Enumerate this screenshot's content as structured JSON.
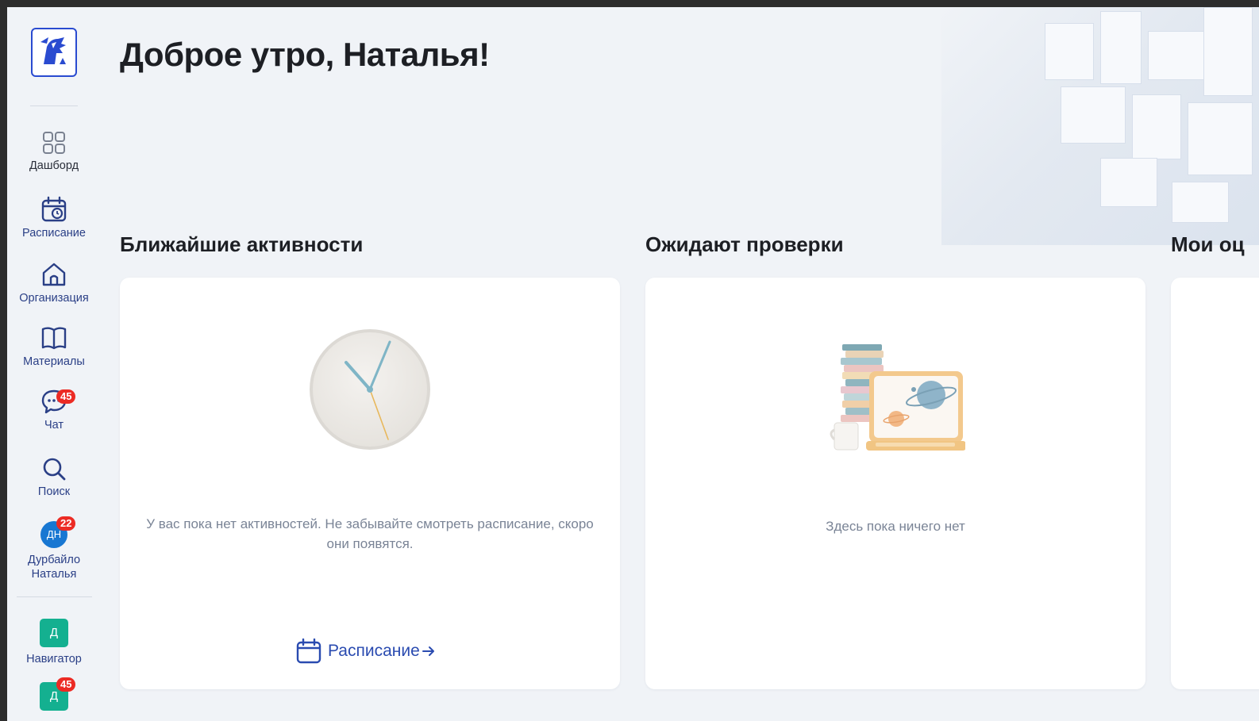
{
  "greeting": "Доброе утро, Наталья!",
  "sidebar": {
    "items": [
      {
        "label": "Дашборд",
        "icon": "grid-icon"
      },
      {
        "label": "Расписание",
        "icon": "calendar-clock-icon"
      },
      {
        "label": "Организация",
        "icon": "home-icon"
      },
      {
        "label": "Материалы",
        "icon": "book-icon"
      },
      {
        "label": "Чат",
        "icon": "chat-icon",
        "badge": "45"
      },
      {
        "label": "Поиск",
        "icon": "search-icon"
      }
    ],
    "user": {
      "initials": "ДН",
      "name_line1": "Дурбайло",
      "name_line2": "Наталья",
      "badge": "22"
    },
    "orgs": [
      {
        "initial": "Д",
        "label": "Навигатор"
      },
      {
        "initial": "Д",
        "badge": "45"
      }
    ]
  },
  "sections": {
    "activities": {
      "title": "Ближайшие активности",
      "empty_text": "У вас пока нет активностей. Не забывайте смотреть расписание, скоро они появятся.",
      "link_label": "Расписание"
    },
    "review": {
      "title": "Ожидают проверки",
      "empty_text": "Здесь пока ничего нет"
    },
    "grades": {
      "title": "Мои оц"
    }
  },
  "colors": {
    "accent": "#2a4bb0",
    "badge": "#ec2b24",
    "avatar": "#1877d2",
    "org_avatar": "#14b090",
    "background": "#f0f3f7"
  }
}
